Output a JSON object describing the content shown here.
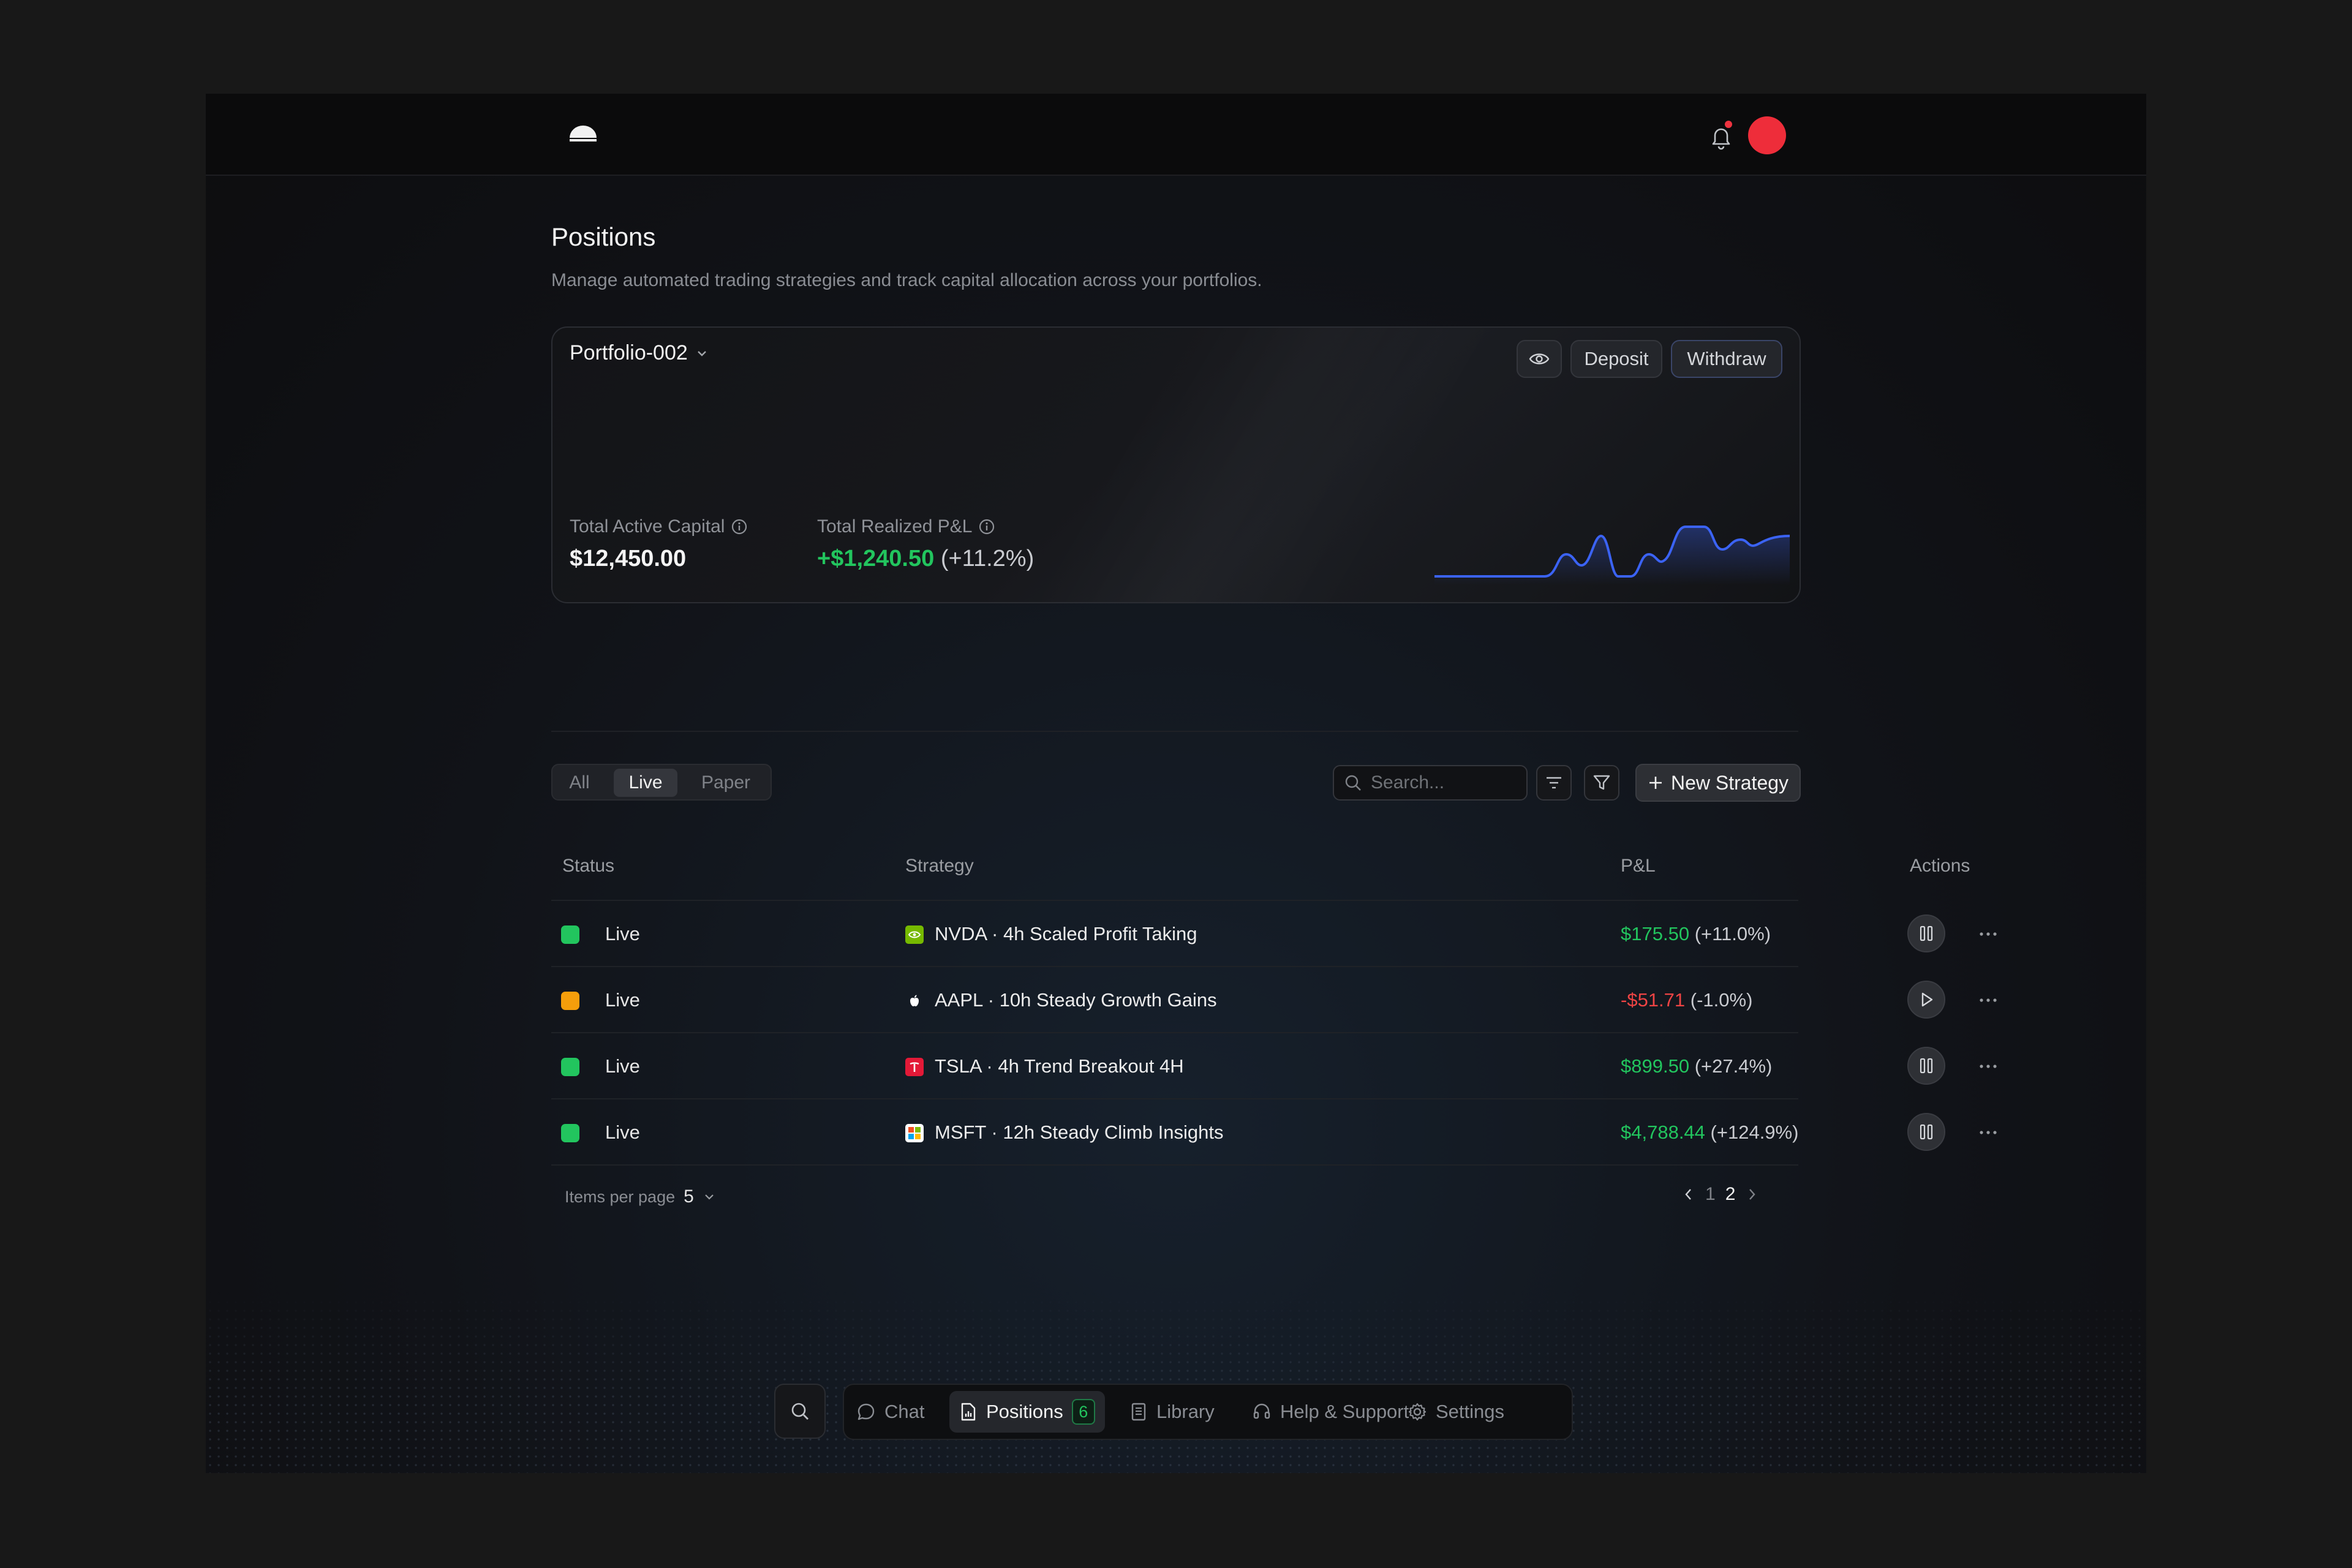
{
  "header": {
    "logo_icon": "half-dome-logo",
    "notifications_icon": "bell-icon",
    "avatar_color": "#ee2d3a"
  },
  "page": {
    "title": "Positions",
    "subtitle": "Manage automated trading strategies and track capital allocation across your portfolios."
  },
  "portfolio": {
    "selected": "Portfolio-002",
    "visibility_icon": "eye-icon",
    "deposit_label": "Deposit",
    "withdraw_label": "Withdraw",
    "total_active_capital_label": "Total Active Capital",
    "total_active_capital_value": "$12,450.00",
    "total_realized_pnl_label": "Total Realized P&L",
    "total_realized_pnl_value": "+$1,240.50",
    "total_realized_pnl_pct": "(+11.2%)",
    "sparkline_color": "#3b63f5"
  },
  "filters": {
    "tabs": [
      "All",
      "Live",
      "Paper"
    ],
    "active_tab": "Live",
    "search_placeholder": "Search...",
    "new_strategy_label": "New Strategy"
  },
  "table": {
    "columns": [
      "Status",
      "Strategy",
      "P&L",
      "Actions"
    ],
    "rows": [
      {
        "status": "Live",
        "status_color": "#22c55e",
        "ticker_icon": "nvidia-icon",
        "strategy": "NVDA · 4h Scaled Profit Taking",
        "pnl": "$175.50",
        "pnl_pct": "(+11.0%)",
        "pnl_sign": "positive",
        "action": "pause"
      },
      {
        "status": "Live",
        "status_color": "#f59e0b",
        "ticker_icon": "apple-icon",
        "strategy": "AAPL · 10h Steady Growth Gains",
        "pnl": "-$51.71",
        "pnl_pct": "(-1.0%)",
        "pnl_sign": "negative",
        "action": "play"
      },
      {
        "status": "Live",
        "status_color": "#22c55e",
        "ticker_icon": "tesla-icon",
        "strategy": "TSLA · 4h Trend Breakout 4H",
        "pnl": "$899.50",
        "pnl_pct": "(+27.4%)",
        "pnl_sign": "positive",
        "action": "pause"
      },
      {
        "status": "Live",
        "status_color": "#22c55e",
        "ticker_icon": "microsoft-icon",
        "strategy": "MSFT · 12h Steady Climb Insights",
        "pnl": "$4,788.44",
        "pnl_pct": "(+124.9%)",
        "pnl_sign": "positive",
        "action": "pause"
      }
    ]
  },
  "pagination": {
    "items_per_page_label": "Items per page",
    "items_per_page_value": "5",
    "pages": [
      "1",
      "2"
    ],
    "current_page": "2"
  },
  "dock": {
    "search_icon": "search-icon",
    "items": [
      {
        "label": "Chat",
        "icon": "chat-bubble-icon"
      },
      {
        "label": "Positions",
        "icon": "document-chart-icon",
        "badge": "6",
        "active": true
      },
      {
        "label": "Library",
        "icon": "book-icon"
      },
      {
        "label": "Help & Support",
        "icon": "headset-icon"
      },
      {
        "label": "Settings",
        "icon": "gear-icon"
      }
    ]
  }
}
